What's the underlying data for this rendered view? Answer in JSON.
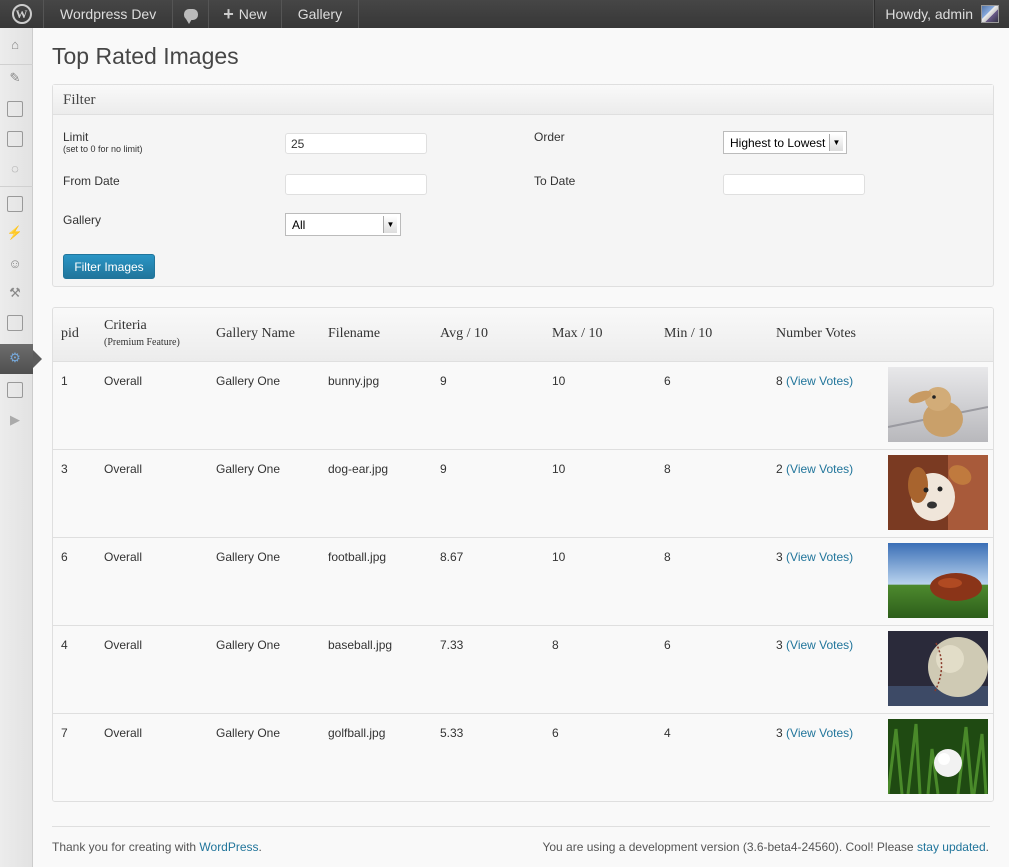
{
  "admin_bar": {
    "site_name": "Wordpress Dev",
    "new_label": "New",
    "gallery_label": "Gallery",
    "howdy": "Howdy, admin"
  },
  "page": {
    "title": "Top Rated Images"
  },
  "filter": {
    "heading": "Filter",
    "limit_label": "Limit",
    "limit_hint": "(set to 0 for no limit)",
    "limit_value": "25",
    "order_label": "Order",
    "order_selected": "Highest to Lowest",
    "from_date_label": "From Date",
    "from_date_value": "",
    "to_date_label": "To Date",
    "to_date_value": "",
    "gallery_label": "Gallery",
    "gallery_selected": "All",
    "button": "Filter Images"
  },
  "table": {
    "columns": {
      "pid": "pid",
      "criteria": "Criteria",
      "criteria_note": "(Premium Feature)",
      "gallery": "Gallery Name",
      "filename": "Filename",
      "avg": "Avg / 10",
      "max": "Max / 10",
      "min": "Min / 10",
      "votes": "Number Votes"
    },
    "view_votes_label": "(View Votes)",
    "rows": [
      {
        "pid": "1",
        "criteria": "Overall",
        "gallery": "Gallery One",
        "filename": "bunny.jpg",
        "avg": "9",
        "max": "10",
        "min": "6",
        "votes": "8"
      },
      {
        "pid": "3",
        "criteria": "Overall",
        "gallery": "Gallery One",
        "filename": "dog-ear.jpg",
        "avg": "9",
        "max": "10",
        "min": "8",
        "votes": "2"
      },
      {
        "pid": "6",
        "criteria": "Overall",
        "gallery": "Gallery One",
        "filename": "football.jpg",
        "avg": "8.67",
        "max": "10",
        "min": "8",
        "votes": "3"
      },
      {
        "pid": "4",
        "criteria": "Overall",
        "gallery": "Gallery One",
        "filename": "baseball.jpg",
        "avg": "7.33",
        "max": "8",
        "min": "6",
        "votes": "3"
      },
      {
        "pid": "7",
        "criteria": "Overall",
        "gallery": "Gallery One",
        "filename": "golfball.jpg",
        "avg": "5.33",
        "max": "6",
        "min": "4",
        "votes": "3"
      }
    ]
  },
  "footer": {
    "left_text": "Thank you for creating with ",
    "left_link": "WordPress",
    "left_end": ".",
    "right_text": "You are using a development version (3.6-beta4-24560). Cool! Please ",
    "right_link": "stay updated",
    "right_end": "."
  },
  "colors": {
    "accent": "#21759b",
    "admin_bar": "#464646"
  }
}
